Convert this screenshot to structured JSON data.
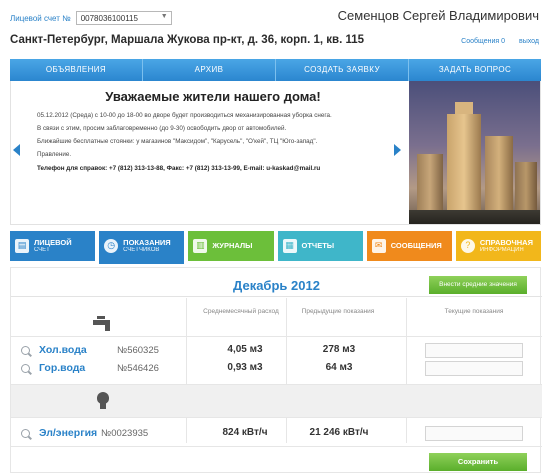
{
  "header": {
    "account_label": "Лицевой счет №",
    "account_value": "0078036100115",
    "user_name": "Семенцов Сергей Владимирович",
    "address": "Санкт-Петербург, Маршала Жукова пр-кт, д. 36, корп. 1, кв. 115",
    "messages_link": "Сообщения 0",
    "logout_link": "выход"
  },
  "main_nav": {
    "items": [
      "ОБЪЯВЛЕНИЯ",
      "АРХИВ",
      "СОЗДАТЬ ЗАЯВКУ",
      "ЗАДАТЬ ВОПРОС"
    ]
  },
  "announcement": {
    "title": "Уважаемые жители нашего дома!",
    "p1": "05.12.2012 (Среда) с 10-00 до 18-00 во дворе будет производиться механизированная уборка снега.",
    "p2": "В связи с этим, просим заблаговременно (до 9-30) освободить двор от автомобилей.",
    "p3": "Ближайшие бесплатные стоянки: у магазинов \"Максидом\", \"Карусель\", \"О'кей\", ТЦ \"Юго-запад\".",
    "p4": "Правление.",
    "contacts": "Телефон для справок: +7 (812) 313-13-88, Факс: +7 (812) 313-13-99, E-mail: u-kaskad@mail.ru"
  },
  "tabs": [
    {
      "l1": "ЛИЦЕВОЙ",
      "l2": "СЧЕТ",
      "color": "#2a82c8"
    },
    {
      "l1": "ПОКАЗАНИЯ",
      "l2": "СЧЕТЧИКОВ",
      "color": "#2a82c8"
    },
    {
      "l1": "ЖУРНАЛЫ",
      "l2": "",
      "color": "#6cbf3a"
    },
    {
      "l1": "ОТЧЕТЫ",
      "l2": "",
      "color": "#3fb6c9"
    },
    {
      "l1": "СООБЩЕНИЯ",
      "l2": "",
      "color": "#f08a1c"
    },
    {
      "l1": "СПРАВОЧНАЯ",
      "l2": "ИНФОРМАЦИЯ",
      "color": "#f2b71b"
    }
  ],
  "meters": {
    "period": "Декабрь 2012",
    "avg_button": "Внести средние значения",
    "col_avg": "Среднемесячный расход",
    "col_prev": "Предыдущие показания",
    "col_current": "Текущие показания",
    "rows": [
      {
        "name": "Хол.вода",
        "number": "№560325",
        "avg": "4,05 м3",
        "prev": "278 м3"
      },
      {
        "name": "Гор.вода",
        "number": "№546426",
        "avg": "0,93 м3",
        "prev": "64 м3"
      },
      {
        "name": "Эл/энергия",
        "number": "№0023935",
        "avg": "824 кВт/ч",
        "prev": "21 246 кВт/ч"
      }
    ],
    "save_button": "Сохранить"
  }
}
